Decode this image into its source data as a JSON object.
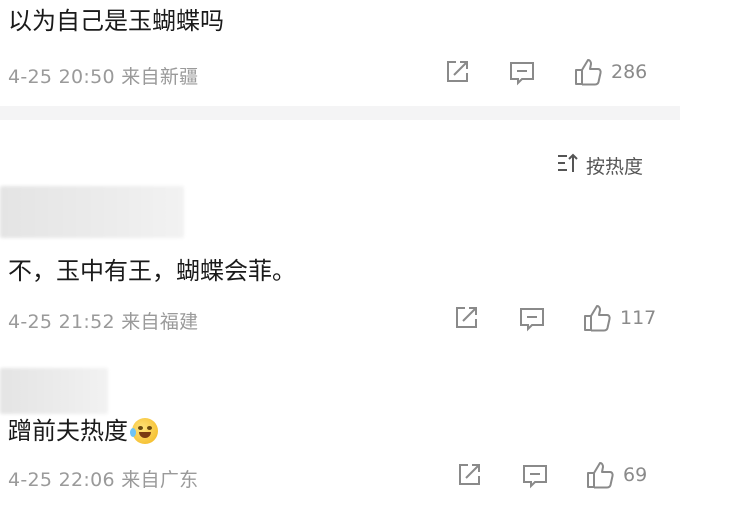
{
  "top_comment": {
    "text": "以为自己是玉蝴蝶吗",
    "meta": "4-25 20:50 来自新疆",
    "likes": "286"
  },
  "sort_label": "按热度",
  "sort_icon": "sort-icon",
  "comments": [
    {
      "text": "不，玉中有王，蝴蝶会菲。",
      "meta": "4-25 21:52 来自福建",
      "likes": "117"
    },
    {
      "text": "蹭前夫热度",
      "meta": "4-25 22:06 来自广东",
      "likes": "69",
      "emoji": "laugh-cry-emoji"
    }
  ],
  "icons": {
    "share": "share-icon",
    "comment": "comment-icon",
    "like": "thumbs-up-icon"
  },
  "colors": {
    "text": "#1a1a1a",
    "meta": "#9a9a9a",
    "icon": "#8a8a8a",
    "divider": "#f4f4f5"
  }
}
